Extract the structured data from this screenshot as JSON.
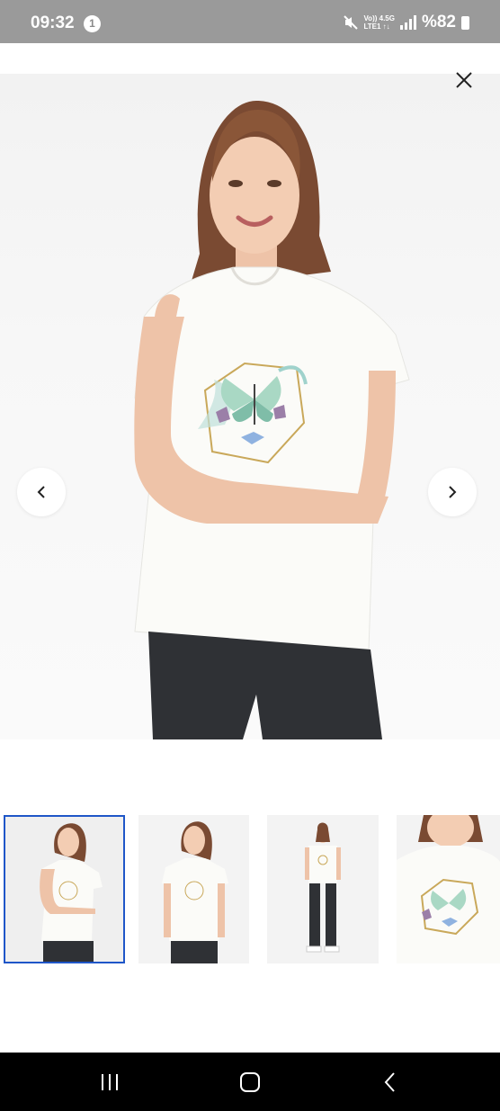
{
  "status_bar": {
    "time": "09:32",
    "notification_count": "1",
    "network_line1": "Vo)) 4.5G",
    "network_line2": "LTE1 ↑↓",
    "battery": "%82"
  },
  "gallery": {
    "close_icon": "close-icon",
    "prev_icon": "chevron-left-icon",
    "next_icon": "chevron-right-icon",
    "thumbnails": [
      {
        "label": "Front view, arm across body",
        "selected": true
      },
      {
        "label": "Front view, standing"
      },
      {
        "label": "Full body view"
      },
      {
        "label": "Close-up print view"
      }
    ]
  },
  "system_nav": {
    "recents_icon": "recents-icon",
    "home_icon": "home-icon",
    "back_icon": "back-icon"
  },
  "colors": {
    "status_bar_bg": "#9a9a9a",
    "selected_border": "#1f56c8",
    "nav_bar_bg": "#000000"
  }
}
